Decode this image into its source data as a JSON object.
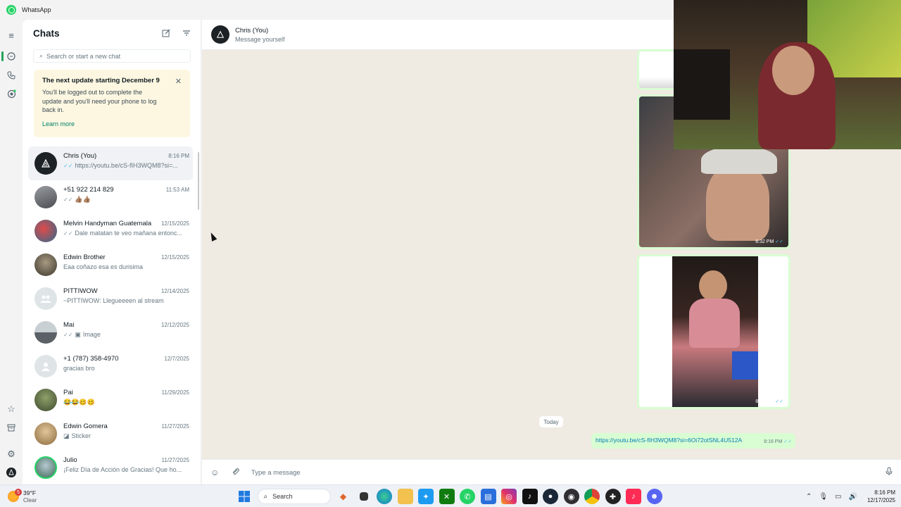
{
  "window": {
    "title": "WhatsApp"
  },
  "sidebar_rail": {
    "icons": [
      "menu-icon",
      "chats-icon",
      "calls-icon",
      "status-icon",
      "starred-icon",
      "archive-icon",
      "settings-icon",
      "profile-icon"
    ]
  },
  "chats": {
    "title": "Chats",
    "search_placeholder": "Search or start a new chat",
    "banner": {
      "title": "The next update starting December 9",
      "text": "You'll be logged out to complete the update and you'll need your phone to log back in.",
      "link": "Learn more"
    },
    "rows": [
      {
        "name": "Chris (You)",
        "time": "8:16 PM",
        "preview": "https://youtu.be/cS-fIH3WQM8?si=...",
        "ticks": "✓✓",
        "tick_color": "blue",
        "avatar_color": "#1c2226"
      },
      {
        "name": "+51 922 214 829",
        "time": "11:53 AM",
        "preview": "👍🏽👍🏽",
        "ticks": "✓✓",
        "tick_color": "grey",
        "avatar_color": "#6b6e72"
      },
      {
        "name": "Melvin Handyman Guatemala",
        "time": "12/15/2025",
        "preview": "Dale matatan te veo mañana entonc...",
        "ticks": "✓✓",
        "tick_color": "grey",
        "avatar_color": "#b83838"
      },
      {
        "name": "Edwin Brother",
        "time": "12/15/2025",
        "preview": "Eaa coñazo esa es durisima",
        "ticks": "",
        "tick_color": "grey",
        "avatar_color": "#5a5145"
      },
      {
        "name": "PITTIWOW",
        "time": "12/14/2025",
        "preview": "~PITTIWOW: Llegueeeen al stream",
        "ticks": "",
        "tick_color": "grey",
        "avatar_color": "#dfe5e7"
      },
      {
        "name": "Mai",
        "time": "12/12/2025",
        "preview": "Image",
        "ticks": "✓✓",
        "tick_color": "grey",
        "avatar_color": "#8c9398"
      },
      {
        "name": "+1 (787) 358-4970",
        "time": "12/7/2025",
        "preview": "gracias bro",
        "ticks": "",
        "tick_color": "grey",
        "avatar_color": "#dfe5e7"
      },
      {
        "name": "Pai",
        "time": "11/29/2025",
        "preview": "😂😂🥴🥴",
        "ticks": "",
        "tick_color": "grey",
        "avatar_color": "#5e6b4a"
      },
      {
        "name": "Edwin Gomera",
        "time": "11/27/2025",
        "preview": "Sticker",
        "ticks": "",
        "tick_color": "grey",
        "avatar_color": "#c9a878"
      },
      {
        "name": "Julio",
        "time": "11/27/2025",
        "preview": "¡Feliz Día de Acción de Gracias! Que ho...",
        "ticks": "",
        "tick_color": "grey",
        "avatar_color": "#4f8a6e"
      }
    ]
  },
  "conversation": {
    "name": "Chris (You)",
    "subtitle": "Message yourself",
    "media_time_1": "8:32 PM",
    "media_time_2": "8:32 PM",
    "day_label": "Today",
    "link_message": "https://youtu.be/cS-fIH3WQM8?si=6Oi72otSNL4U512A",
    "link_time": "8:16 PM",
    "composer_placeholder": "Type a message"
  },
  "taskbar": {
    "weather_temp": "39°F",
    "weather_cond": "Clear",
    "weather_badge": "5",
    "search_label": "Search",
    "clock_time": "8:16 PM",
    "clock_date": "12/17/2025"
  },
  "colors": {
    "accent": "#25d366",
    "outgoing_bubble": "#d9fdd3",
    "chat_background": "#efeae2",
    "read_ticks": "#53bdeb"
  }
}
